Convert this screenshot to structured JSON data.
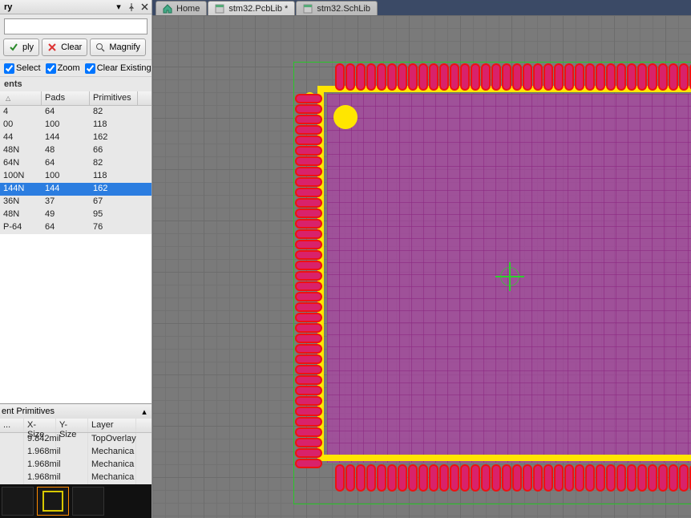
{
  "panel": {
    "title": "ry",
    "mask_value": "",
    "buttons": {
      "apply": "ply",
      "clear": "Clear",
      "magnify": "Magnify"
    },
    "checks": {
      "select": "Select",
      "zoom": "Zoom",
      "clear_existing": "Clear Existing"
    }
  },
  "components": {
    "heading": "ents",
    "columns": {
      "name": "",
      "pads": "Pads",
      "primitives": "Primitives"
    },
    "rows": [
      {
        "name": "4",
        "pads": "64",
        "prim": "82",
        "sel": false
      },
      {
        "name": "00",
        "pads": "100",
        "prim": "118",
        "sel": false
      },
      {
        "name": "44",
        "pads": "144",
        "prim": "162",
        "sel": false
      },
      {
        "name": "48N",
        "pads": "48",
        "prim": "66",
        "sel": false
      },
      {
        "name": "64N",
        "pads": "64",
        "prim": "82",
        "sel": false
      },
      {
        "name": "100N",
        "pads": "100",
        "prim": "118",
        "sel": false
      },
      {
        "name": "144N",
        "pads": "144",
        "prim": "162",
        "sel": true
      },
      {
        "name": "36N",
        "pads": "37",
        "prim": "67",
        "sel": false
      },
      {
        "name": "48N",
        "pads": "49",
        "prim": "95",
        "sel": false
      },
      {
        "name": "P-64",
        "pads": "64",
        "prim": "76",
        "sel": false
      }
    ]
  },
  "primitives": {
    "heading": "ent Primitives",
    "columns": {
      "type": "...",
      "x": "X-Size",
      "y": "Y-Size",
      "layer": "Layer"
    },
    "rows": [
      {
        "t": "",
        "x": "9.842mil",
        "y": "",
        "layer": "TopOverlay"
      },
      {
        "t": "",
        "x": "1.968mil",
        "y": "",
        "layer": "Mechanica"
      },
      {
        "t": "",
        "x": "1.968mil",
        "y": "",
        "layer": "Mechanica"
      },
      {
        "t": "",
        "x": "1.968mil",
        "y": "",
        "layer": "Mechanica"
      }
    ]
  },
  "tabs": [
    {
      "label": "Home",
      "active": false,
      "icon": "home-icon"
    },
    {
      "label": "stm32.PcbLib *",
      "active": true,
      "icon": "pcblib-icon"
    },
    {
      "label": "stm32.SchLib",
      "active": false,
      "icon": "schlib-icon"
    }
  ]
}
